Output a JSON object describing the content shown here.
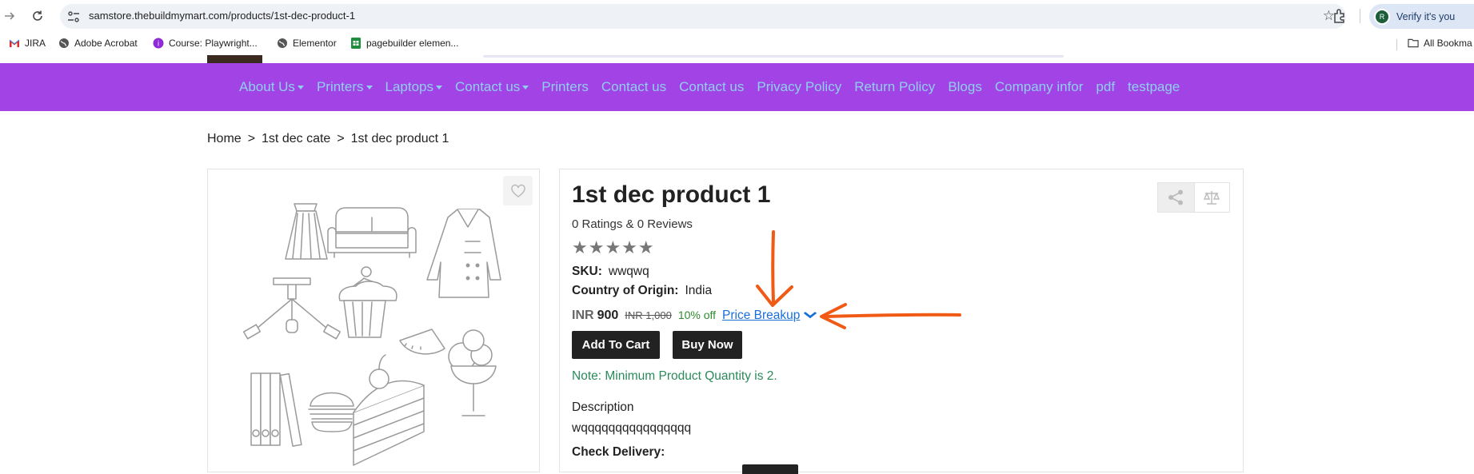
{
  "browser": {
    "url": "samstore.thebuildmymart.com/products/1st-dec-product-1",
    "profile_label": "Verify it's you",
    "profile_initial": "R",
    "bookmarks": [
      {
        "label": "JIRA",
        "icon": "gmail-icon"
      },
      {
        "label": "Adobe Acrobat",
        "icon": "globe-icon"
      },
      {
        "label": "Course: Playwright...",
        "icon": "course-icon"
      },
      {
        "label": "Elementor",
        "icon": "globe-icon"
      },
      {
        "label": "pagebuilder elemen...",
        "icon": "sheets-icon"
      }
    ],
    "all_bookmarks_label": "All Bookma"
  },
  "nav": {
    "items": [
      {
        "label": "About Us",
        "dropdown": true
      },
      {
        "label": "Printers",
        "dropdown": true
      },
      {
        "label": "Laptops",
        "dropdown": true
      },
      {
        "label": "Contact us",
        "dropdown": true
      },
      {
        "label": "Printers",
        "dropdown": false
      },
      {
        "label": "Contact us",
        "dropdown": false
      },
      {
        "label": "Contact us",
        "dropdown": false
      },
      {
        "label": "Privacy Policy",
        "dropdown": false
      },
      {
        "label": "Return Policy",
        "dropdown": false
      },
      {
        "label": "Blogs",
        "dropdown": false
      },
      {
        "label": "Company infor",
        "dropdown": false
      },
      {
        "label": "pdf",
        "dropdown": false
      },
      {
        "label": "testpage",
        "dropdown": false
      }
    ]
  },
  "breadcrumb": {
    "items": [
      "Home",
      "1st dec cate",
      "1st dec product 1"
    ],
    "separator": ">"
  },
  "product": {
    "title": "1st dec product 1",
    "ratings_text": "0 Ratings & 0 Reviews",
    "stars": "★★★★★",
    "sku_label": "SKU:",
    "sku_value": "wwqwq",
    "origin_label": "Country of Origin:",
    "origin_value": "India",
    "currency": "INR",
    "price": "900",
    "old_price": "INR 1,000",
    "discount": "10% off",
    "price_breakup_label": "Price Breakup",
    "add_to_cart_label": "Add To Cart",
    "buy_now_label": "Buy Now",
    "note": "Note: Minimum Product Quantity is 2.",
    "description_label": "Description",
    "description_value": "wqqqqqqqqqqqqqqqq",
    "check_delivery_label": "Check Delivery:"
  },
  "colors": {
    "nav_bg": "#a243e6",
    "nav_link": "#8ed0f0",
    "annotation": "#f05a14",
    "note": "#2a8a5a",
    "link": "#1a6fd6"
  }
}
